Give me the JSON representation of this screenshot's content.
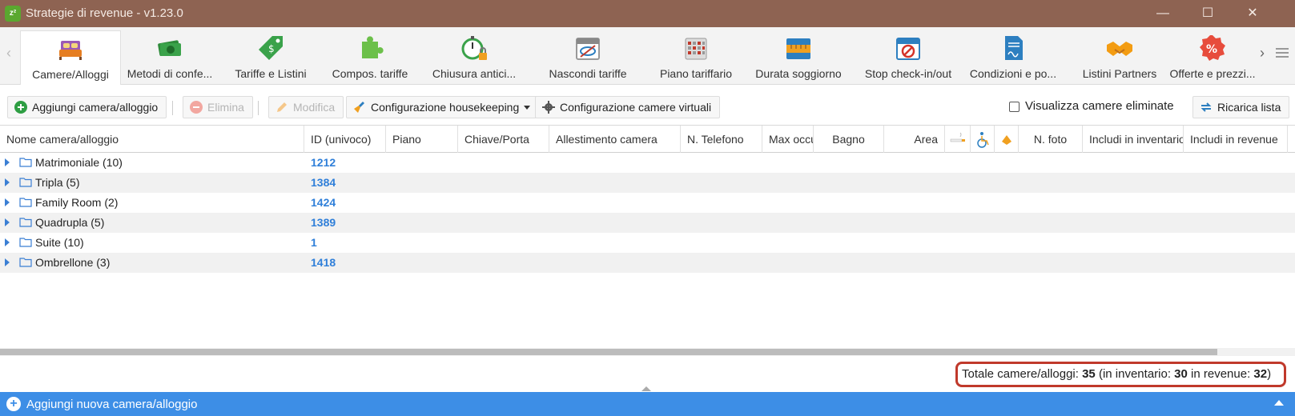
{
  "window": {
    "title": "Strategie di revenue - v1.23.0",
    "minimize": "—",
    "maximize": "☐",
    "close": "✕"
  },
  "ribbon": {
    "tabs": [
      {
        "label": "Camere/Alloggi",
        "icon": "bed-icon",
        "active": true
      },
      {
        "label": "Metodi di confe...",
        "icon": "money-icon"
      },
      {
        "label": "Tariffe e Listini",
        "icon": "price-tag-icon"
      },
      {
        "label": "Compos. tariffe",
        "icon": "puzzle-icon"
      },
      {
        "label": "Chiusura antici...",
        "icon": "stopwatch-lock-icon"
      },
      {
        "label": "Nascondi tariffe",
        "icon": "calendar-hidden-icon"
      },
      {
        "label": "Piano tariffario",
        "icon": "calendar-grid-icon"
      },
      {
        "label": "Durata soggiorno",
        "icon": "calendar-ruler-icon"
      },
      {
        "label": "Stop check-in/out",
        "icon": "calendar-stop-icon"
      },
      {
        "label": "Condizioni e po...",
        "icon": "document-signature-icon"
      },
      {
        "label": "Listini Partners",
        "icon": "handshake-icon"
      },
      {
        "label": "Offerte e prezzi...",
        "icon": "discount-badge-icon"
      }
    ]
  },
  "toolbar": {
    "add_label": "Aggiungi camera/alloggio",
    "delete_label": "Elimina",
    "edit_label": "Modifica",
    "housekeeping_label": "Configurazione housekeeping",
    "virtual_label": "Configurazione camere virtuali",
    "show_deleted_label": "Visualizza camere eliminate",
    "reload_label": "Ricarica lista"
  },
  "grid": {
    "columns": [
      "Nome camera/alloggio",
      "ID (univoco)",
      "Piano",
      "Chiave/Porta",
      "Allestimento camera",
      "N. Telefono",
      "Max occu",
      "Bagno",
      "Area",
      "",
      "",
      "",
      "N. foto",
      "Includi in inventario",
      "Includi in revenue"
    ],
    "rows": [
      {
        "name": "Matrimoniale (10)",
        "id": "1212"
      },
      {
        "name": "Tripla (5)",
        "id": "1384"
      },
      {
        "name": "Family Room (2)",
        "id": "1424"
      },
      {
        "name": "Quadrupla (5)",
        "id": "1389"
      },
      {
        "name": "Suite (10)",
        "id": "1"
      },
      {
        "name": "Ombrellone (3)",
        "id": "1418"
      }
    ]
  },
  "footer": {
    "total_prefix": "Totale camere/alloggi: ",
    "total": "35",
    "inv_prefix": " (in inventario: ",
    "inventory": "30",
    "rev_prefix": " in revenue: ",
    "revenue": "32",
    "suffix": ")"
  },
  "bottom_bar": {
    "label": "Aggiungi nuova camera/alloggio"
  },
  "colors": {
    "titlebar": "#8e6352",
    "accent": "#3d8ee6",
    "id_text": "#2f7fd9",
    "highlight": "#c0392b"
  }
}
